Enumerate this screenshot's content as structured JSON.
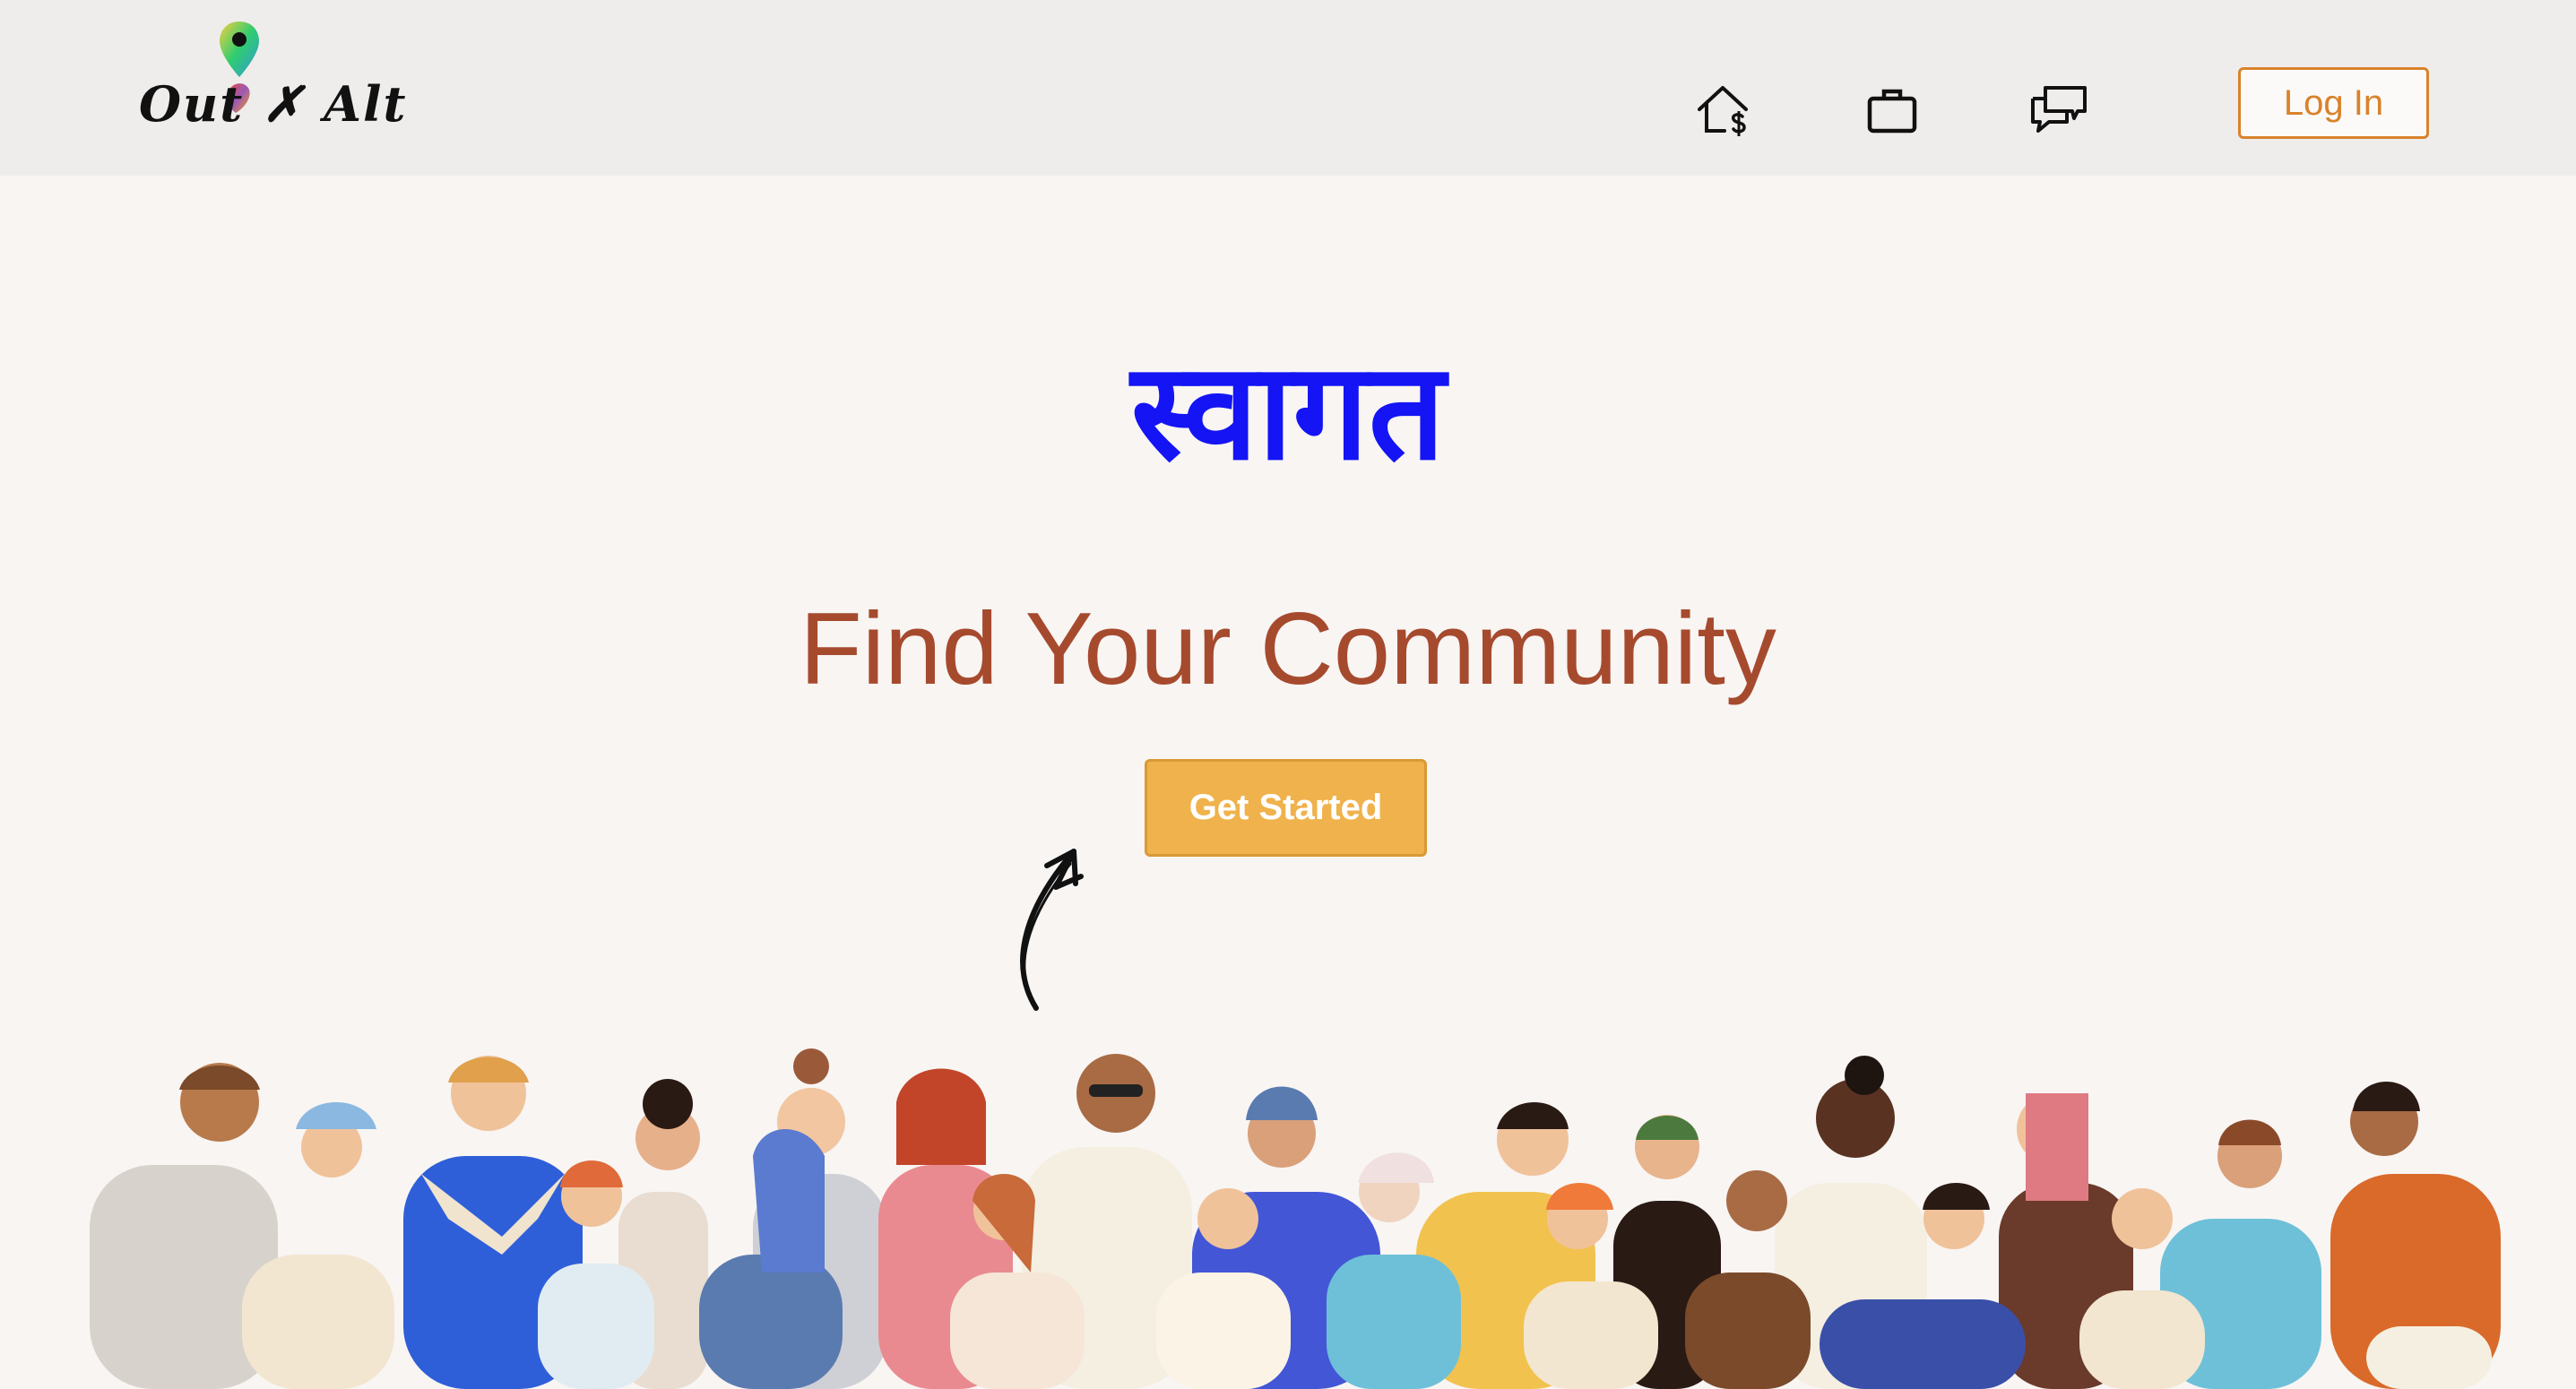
{
  "header": {
    "logo_text": "Out ✗ Alt",
    "nav": [
      {
        "icon": "home-dollar-icon"
      },
      {
        "icon": "briefcase-icon"
      },
      {
        "icon": "chat-bubbles-icon"
      }
    ],
    "login_label": "Log In"
  },
  "hero": {
    "welcome": "स्वागत",
    "title": "Find Your Community",
    "cta_label": "Get Started"
  },
  "colors": {
    "header_bg": "#efedeb",
    "page_bg": "#f8f5f3",
    "welcome": "#1414f5",
    "title": "#a64a2e",
    "cta_bg": "#f0b24c",
    "login_accent": "#d9822b"
  }
}
